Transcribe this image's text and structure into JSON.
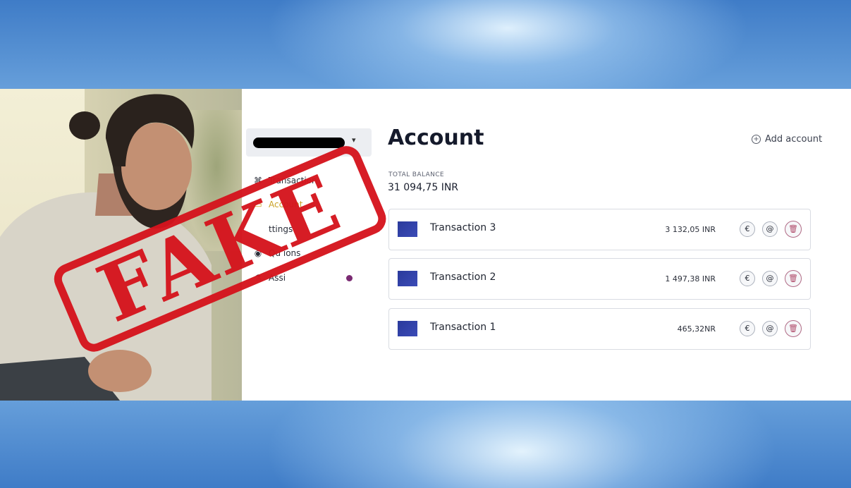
{
  "sidebar": {
    "account_selector_caret": "▾",
    "items": [
      {
        "label": "Transaction",
        "icon": "grid-icon",
        "glyph": "⌘",
        "active": false
      },
      {
        "label": "Account",
        "icon": "card-icon",
        "glyph": "▭",
        "active": true
      },
      {
        "label": "ttings",
        "icon": "settings-icon",
        "glyph": "",
        "active": false
      },
      {
        "label": "Qu  ions",
        "icon": "help-icon",
        "glyph": "◉",
        "active": false
      },
      {
        "label": "Assi",
        "icon": "flask-icon",
        "glyph": "⚗",
        "active": false
      }
    ]
  },
  "main": {
    "title": "Account",
    "add_account_label": "Add account",
    "total_balance_label": "TOTAL BALANCE",
    "total_balance_value": "31 094,75 INR",
    "transactions": [
      {
        "name": "Transaction 3",
        "amount": "3 132,05 INR"
      },
      {
        "name": "Transaction 2",
        "amount": "1 497,38 INR"
      },
      {
        "name": "Transaction 1",
        "amount": "465,32NR"
      }
    ],
    "action_glyphs": {
      "exchange": "€",
      "mention": "@",
      "delete": "🗑"
    }
  },
  "stamp": {
    "text": "FAKE",
    "color": "#d5141d"
  },
  "colors": {
    "accent": "#c9a227",
    "background_blue": "#5b8fd0",
    "stamp_red": "#d5141d"
  }
}
